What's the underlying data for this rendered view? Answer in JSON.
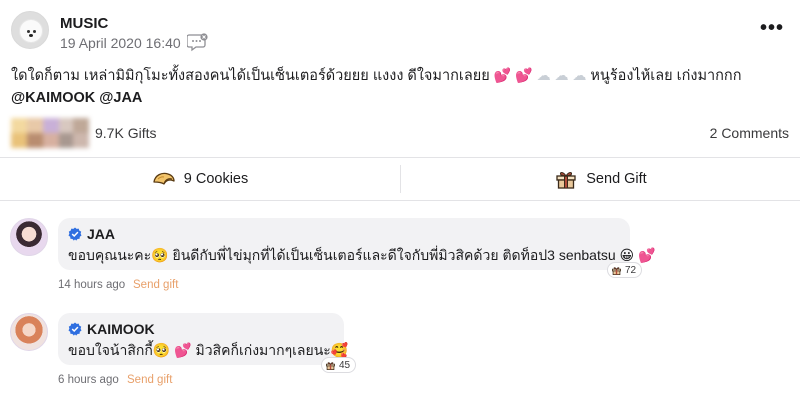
{
  "post": {
    "author": "MUSIC",
    "date": "19 April 2020 16:40",
    "body_text": "ใดใดก็ตาม เหล่ามิมิกุโมะทั้งสองคนได้เป็นเซ็นเตอร์ด้วยยย แงงง ดีใจมากเลยย",
    "body_emojis_hearts": "💕 💕",
    "body_emojis_clouds": "☁ ☁ ☁",
    "body_after": "หนูร้องไห้เลย เก่งมากกก",
    "mentions": "@KAIMOOK @JAA",
    "gifts_count": "9.7K Gifts",
    "comments_count": "2 Comments"
  },
  "actions": {
    "cookies_label": "9 Cookies",
    "send_gift_label": "Send Gift"
  },
  "comments": [
    {
      "name": "JAA",
      "text": "ขอบคุณนะคะ🥺 ยินดีกับพี่ไข่มุกที่ได้เป็นเซ็นเตอร์และดีใจกับพี่มิวสิคด้วย ติดท็อป3 senbatsu 😀 💕",
      "gift_count": "72",
      "time": "14 hours ago",
      "send_gift": "Send gift"
    },
    {
      "name": "KAIMOOK",
      "text": "ขอบใจน้าสิกกี้🥺 💕 มิวสิคก็เก่งมากๆเลยนะ🥰",
      "gift_count": "45",
      "time": "6 hours ago",
      "send_gift": "Send gift"
    }
  ],
  "icons": {
    "more": "more-options-icon",
    "chat": "chat-bubble-icon",
    "cookie": "fortune-cookie-icon",
    "gift": "gift-box-icon",
    "verified": "verified-badge-icon"
  },
  "colors": {
    "verified_blue": "#2f6fe0",
    "send_gift_link": "#e8a06a",
    "heart_pink": "#ff4fa3",
    "divider": "#e3e3e6",
    "bubble_bg": "#f2f2f4"
  }
}
